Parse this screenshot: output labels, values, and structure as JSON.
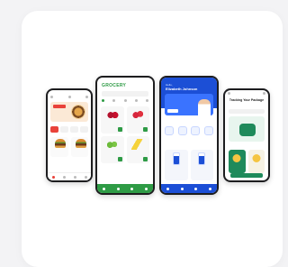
{
  "grocery_app": {
    "title": "GROCERY"
  },
  "pharmacy_app": {
    "greeting": "Hello,",
    "user_name": "Elizabeth Johnson"
  },
  "tracking_app": {
    "title": "Tracking Your Package"
  }
}
